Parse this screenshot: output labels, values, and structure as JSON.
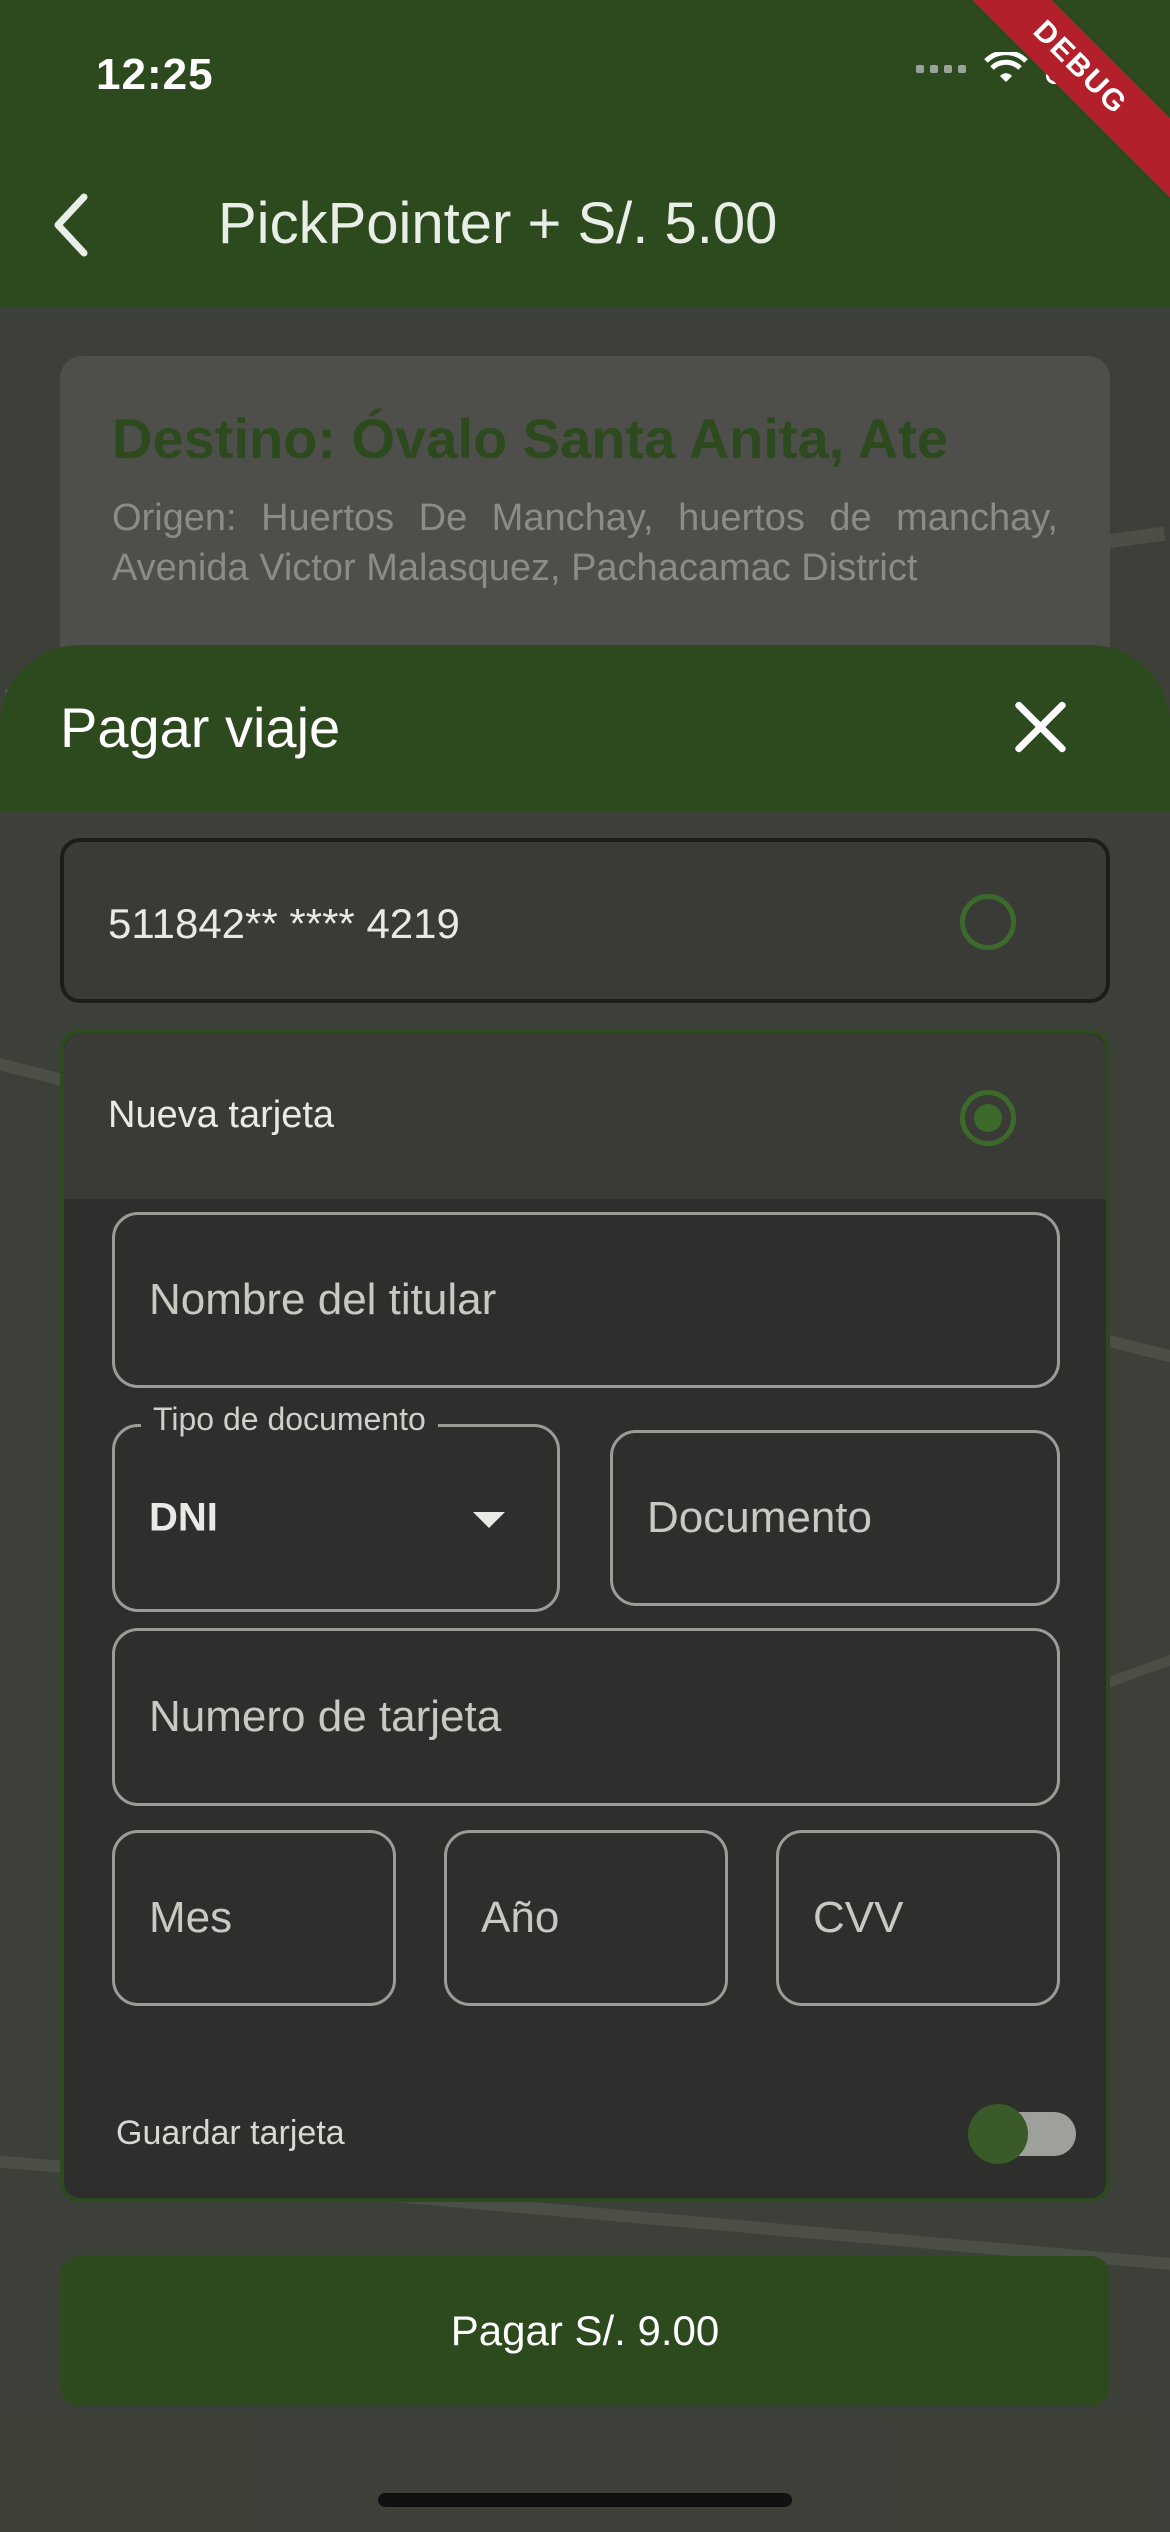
{
  "status_bar": {
    "time": "12:25",
    "debug_label": "DEBUG"
  },
  "app_bar": {
    "title": "PickPointer + S/. 5.00"
  },
  "destination_card": {
    "title": "Destino: Óvalo Santa Anita, Ate",
    "origin": "Origen: Huertos De Manchay, huertos de manchay, Avenida Victor Malasquez, Pachacamac District"
  },
  "sheet": {
    "title": "Pagar viaje",
    "saved_card": {
      "label": "511842** **** 4219",
      "selected": false
    },
    "new_card": {
      "label": "Nueva tarjeta",
      "selected": true,
      "fields": {
        "holder_name": {
          "placeholder": "Nombre del titular"
        },
        "doc_type": {
          "label": "Tipo de documento",
          "value": "DNI"
        },
        "document": {
          "placeholder": "Documento"
        },
        "card_number": {
          "placeholder": "Numero de tarjeta"
        },
        "month": {
          "placeholder": "Mes"
        },
        "year": {
          "placeholder": "Año"
        },
        "cvv": {
          "placeholder": "CVV"
        }
      },
      "save_card": {
        "label": "Guardar tarjeta",
        "enabled": false
      }
    },
    "pay_button": "Pagar S/. 9.00"
  },
  "colors": {
    "primary": "#2c4a1e",
    "accent": "#3c6a2b",
    "ribbon": "#b3202c"
  }
}
